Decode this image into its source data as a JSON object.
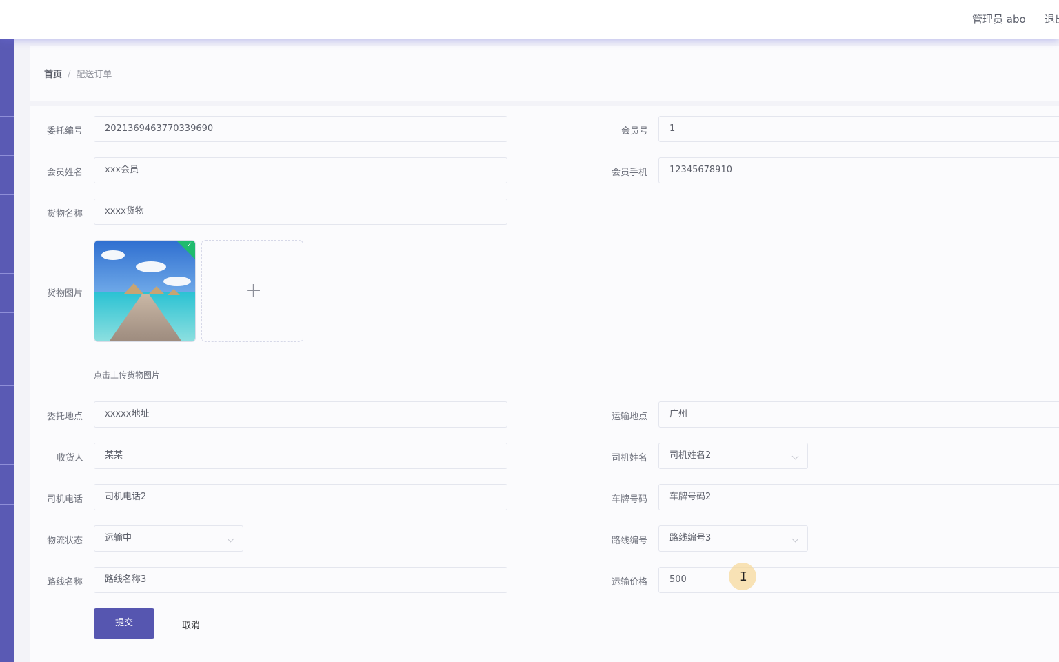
{
  "header": {
    "admin_label": "管理员 abo",
    "logout_label": "退出"
  },
  "breadcrumb": {
    "home": "首页",
    "separator": "/",
    "current": "配送订单"
  },
  "form": {
    "commission_no": {
      "label": "委托编号",
      "value": "2021369463770339690"
    },
    "member_no": {
      "label": "会员号",
      "value": "1"
    },
    "member_name": {
      "label": "会员姓名",
      "value": "xxx会员"
    },
    "member_phone": {
      "label": "会员手机",
      "value": "12345678910"
    },
    "goods_name": {
      "label": "货物名称",
      "value": "xxxx货物"
    },
    "goods_image": {
      "label": "货物图片",
      "hint": "点击上传货物图片"
    },
    "commission_place": {
      "label": "委托地点",
      "value": "xxxxx地址"
    },
    "transport_place": {
      "label": "运输地点",
      "value": "广州"
    },
    "consignee": {
      "label": "收货人",
      "value": "某某"
    },
    "driver_name": {
      "label": "司机姓名",
      "value": "司机姓名2"
    },
    "driver_phone": {
      "label": "司机电话",
      "value": "司机电话2"
    },
    "plate_no": {
      "label": "车牌号码",
      "value": "车牌号码2"
    },
    "logistics_status": {
      "label": "物流状态",
      "value": "运输中"
    },
    "route_no": {
      "label": "路线编号",
      "value": "路线编号3"
    },
    "route_name": {
      "label": "路线名称",
      "value": "路线名称3"
    },
    "transport_price": {
      "label": "运输价格",
      "value": "500"
    },
    "submit_label": "提交",
    "cancel_label": "取消"
  },
  "colors": {
    "sidebar": "#5a5ab4",
    "primary_button": "#5656b0",
    "upload_success": "#1fbb6e"
  },
  "icons": {
    "upload_plus": "plus-icon",
    "upload_success": "check-icon",
    "select_arrow": "chevron-down-icon",
    "text_cursor": "text-cursor-icon"
  }
}
